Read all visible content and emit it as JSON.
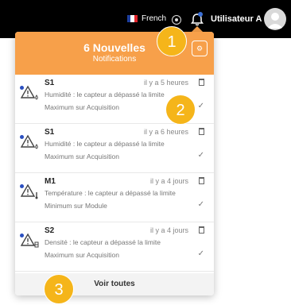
{
  "topbar": {
    "language": "French",
    "user_name": "Utilisateur A",
    "flag_colors": [
      "#1f3f9e",
      "#ffffff",
      "#e1242b"
    ]
  },
  "panel": {
    "title": "6 Nouvelles",
    "subtitle": "Notifications",
    "header_button_icon": "gear-icon",
    "accent": "#f7a04a",
    "footer_label": "Voir toutes"
  },
  "notifications": [
    {
      "title": "S1",
      "time": "il y a 5 heures",
      "desc": "Humidité : le capteur a dépassé la limite",
      "sub": "Maximum sur Acquisition",
      "sensor_icon": "drop-icon"
    },
    {
      "title": "S1",
      "time": "il y a 6 heures",
      "desc": "Humidité : le capteur a dépassé la limite",
      "sub": "Maximum sur Acquisition",
      "sensor_icon": "drop-icon"
    },
    {
      "title": "M1",
      "time": "il y a 4 jours",
      "desc": "Température : le capteur a dépassé la limite",
      "sub": "Minimum sur Module",
      "sensor_icon": "thermometer-icon"
    },
    {
      "title": "S2",
      "time": "il y a 4 jours",
      "desc": "Densité : le capteur a dépassé la limite",
      "sub": "Maximum sur Acquisition",
      "sensor_icon": "density-icon"
    }
  ],
  "badges": [
    "1",
    "2",
    "3"
  ]
}
